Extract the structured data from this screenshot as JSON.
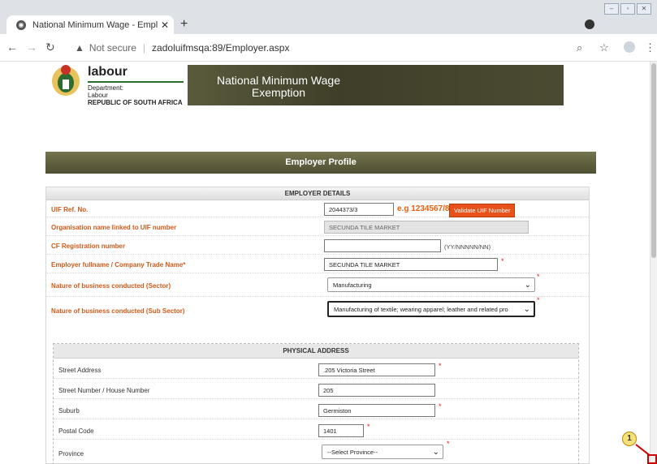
{
  "browser": {
    "tab_title": "National Minimum Wage - Empl",
    "new_tab": "+",
    "not_secure": "Not secure",
    "url": "zadoluifmsqa:89/Employer.aspx"
  },
  "header": {
    "org_name": "labour",
    "dept_line1": "Department:",
    "dept_line2": "Labour",
    "republic": "REPUBLIC OF SOUTH AFRICA",
    "banner_line1": "National Minimum Wage",
    "banner_line2": "Exemption"
  },
  "profile_title": "Employer Profile",
  "employer_details": {
    "heading": "EMPLOYER DETAILS",
    "uif_label": "UIF Ref. No.",
    "uif_value": "2044373/3",
    "uif_example": "e.g 1234567/8",
    "validate_button": "Validate UIF Number",
    "org_label": "Organisation name linked to UIF number",
    "org_value": "SECUNDA TILE MARKET",
    "cf_label": "CF Registration number",
    "cf_value": "",
    "cf_hint": "(YY/NNNNN/NN)",
    "fullname_label": "Employer fullname / Company Trade Name*",
    "fullname_value": "SECUNDA TILE MARKET",
    "sector_label": "Nature of business conducted (Sector)",
    "sector_value": "Manufacturing",
    "subsector_label": "Nature of business conducted (Sub Sector)",
    "subsector_value": "Manufacturing of textile; wearing apparel; leather and related pro",
    "required_mark": "*"
  },
  "physical_address": {
    "heading": "PHYSICAL ADDRESS",
    "street_label": "Street Address",
    "street_value": ".205 Victoria Street",
    "number_label": "Street Number / House Number",
    "number_value": "205",
    "suburb_label": "Suburb",
    "suburb_value": "Germiston",
    "postal_label": "Postal Code",
    "postal_value": "1401",
    "province_label": "Province",
    "province_value": "--Select Province--"
  },
  "annotation": {
    "number": "1"
  },
  "colors": {
    "label_orange": "#d05a1a",
    "button_orange": "#e8521a",
    "banner_olive": "#4f4f33"
  }
}
